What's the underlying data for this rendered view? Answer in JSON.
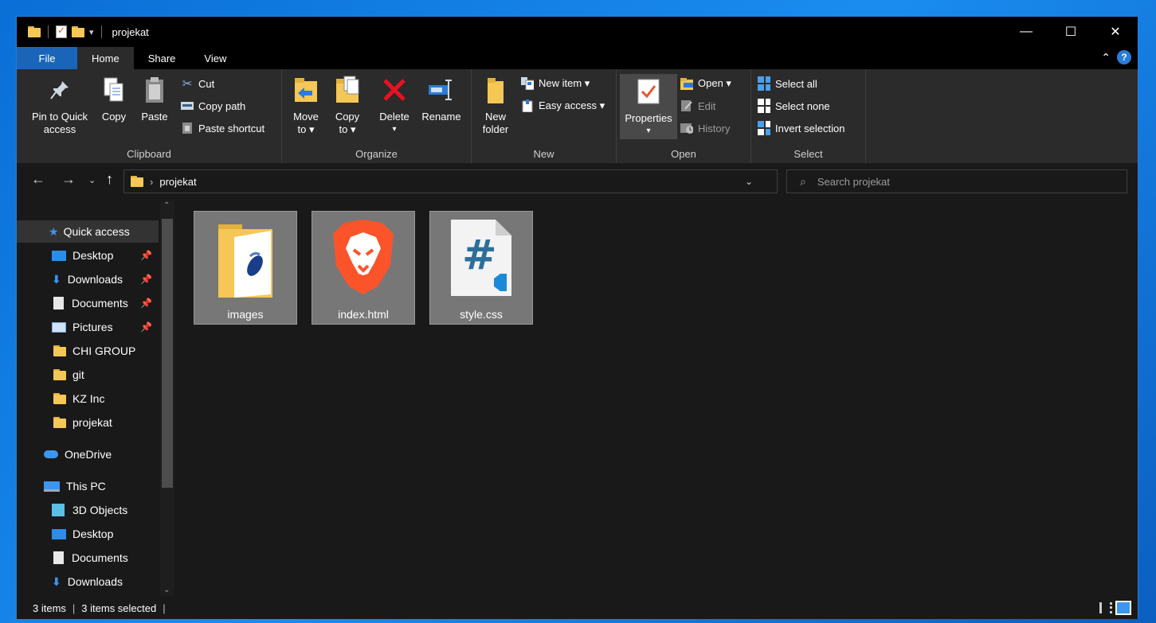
{
  "window": {
    "title": "projekat"
  },
  "titlebar": {
    "minimize": "—",
    "maximize": "☐",
    "close": "✕"
  },
  "tabs": [
    {
      "label": "File"
    },
    {
      "label": "Home"
    },
    {
      "label": "Share"
    },
    {
      "label": "View"
    }
  ],
  "ribbon": {
    "clipboard": {
      "label": "Clipboard",
      "pin_to_quick_access": "Pin to Quick access",
      "copy": "Copy",
      "paste": "Paste",
      "cut": "Cut",
      "copy_path": "Copy path",
      "paste_shortcut": "Paste shortcut"
    },
    "organize": {
      "label": "Organize",
      "move_to_l1": "Move",
      "move_to_l2": "to ▾",
      "copy_to_l1": "Copy",
      "copy_to_l2": "to ▾",
      "delete": "Delete",
      "delete_arrow": "▾",
      "rename": "Rename"
    },
    "new": {
      "label": "New",
      "new_folder_l1": "New",
      "new_folder_l2": "folder",
      "new_item": "New item ▾",
      "easy_access": "Easy access ▾"
    },
    "open": {
      "label": "Open",
      "properties": "Properties",
      "properties_arrow": "▾",
      "open": "Open ▾",
      "edit": "Edit",
      "history": "History"
    },
    "select": {
      "label": "Select",
      "select_all": "Select all",
      "select_none": "Select none",
      "invert_selection": "Invert selection"
    }
  },
  "address": {
    "path_segment": "projekat",
    "search_placeholder": "Search projekat"
  },
  "nav": {
    "quick_access": "Quick access",
    "items": [
      {
        "label": "Desktop"
      },
      {
        "label": "Downloads"
      },
      {
        "label": "Documents"
      },
      {
        "label": "Pictures"
      },
      {
        "label": "CHI GROUP"
      },
      {
        "label": "git"
      },
      {
        "label": "KZ Inc"
      },
      {
        "label": "projekat"
      }
    ],
    "onedrive": "OneDrive",
    "this_pc": "This PC",
    "pc_items": [
      {
        "label": "3D Objects"
      },
      {
        "label": "Desktop"
      },
      {
        "label": "Documents"
      },
      {
        "label": "Downloads"
      }
    ]
  },
  "files": [
    {
      "name": "images"
    },
    {
      "name": "index.html"
    },
    {
      "name": "style.css"
    }
  ],
  "status": {
    "items_count": "3 items",
    "selected": "3 items selected"
  },
  "colors": {
    "accent": "#1a65b8",
    "folder": "#f5c756",
    "brave": "#fb542b"
  }
}
